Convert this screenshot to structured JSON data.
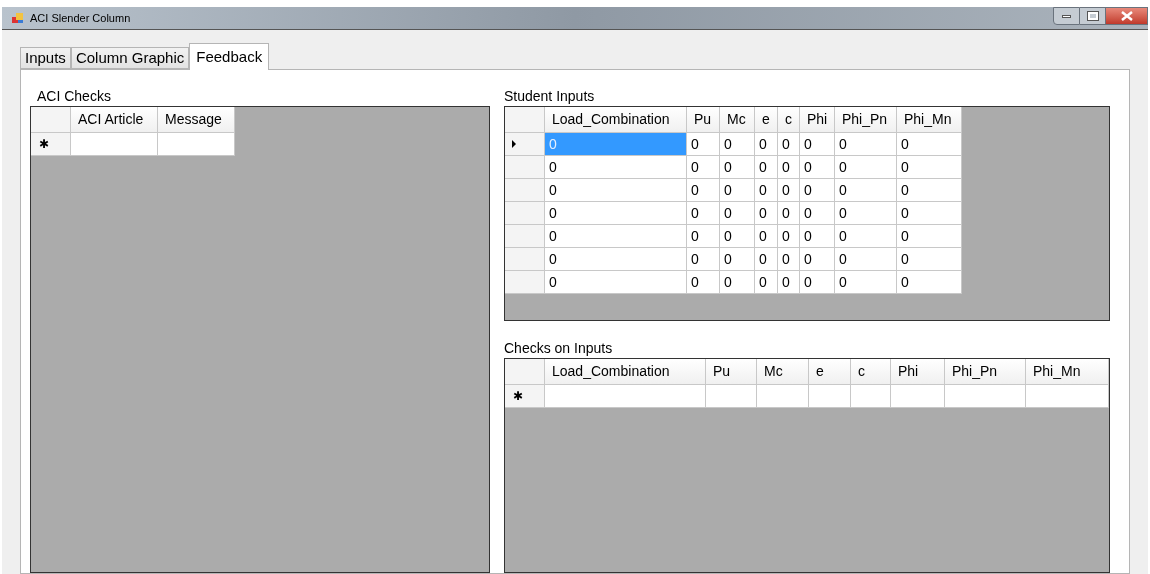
{
  "window": {
    "title": "ACI Slender Column"
  },
  "tabs": [
    {
      "label": "Inputs",
      "selected": false
    },
    {
      "label": "Column Graphic",
      "selected": false
    },
    {
      "label": "Feedback",
      "selected": true
    }
  ],
  "aci_checks": {
    "title": "ACI Checks",
    "columns": [
      "ACI Article",
      "Message"
    ],
    "new_row_marker": "✱"
  },
  "student_inputs": {
    "title": "Student Inputs",
    "columns": [
      "Load_Combination",
      "Pu",
      "Mc",
      "e",
      "c",
      "Phi",
      "Phi_Pn",
      "Phi_Mn"
    ],
    "rows": [
      {
        "selected": true,
        "cells": [
          "0",
          "0",
          "0",
          "0",
          "0",
          "0",
          "0",
          "0"
        ]
      },
      {
        "selected": false,
        "cells": [
          "0",
          "0",
          "0",
          "0",
          "0",
          "0",
          "0",
          "0"
        ]
      },
      {
        "selected": false,
        "cells": [
          "0",
          "0",
          "0",
          "0",
          "0",
          "0",
          "0",
          "0"
        ]
      },
      {
        "selected": false,
        "cells": [
          "0",
          "0",
          "0",
          "0",
          "0",
          "0",
          "0",
          "0"
        ]
      },
      {
        "selected": false,
        "cells": [
          "0",
          "0",
          "0",
          "0",
          "0",
          "0",
          "0",
          "0"
        ]
      },
      {
        "selected": false,
        "cells": [
          "0",
          "0",
          "0",
          "0",
          "0",
          "0",
          "0",
          "0"
        ]
      },
      {
        "selected": false,
        "cells": [
          "0",
          "0",
          "0",
          "0",
          "0",
          "0",
          "0",
          "0"
        ]
      }
    ]
  },
  "checks_on_inputs": {
    "title": "Checks on Inputs",
    "columns": [
      "Load_Combination",
      "Pu",
      "Mc",
      "e",
      "c",
      "Phi",
      "Phi_Pn",
      "Phi_Mn"
    ],
    "new_row_marker": "✱"
  }
}
